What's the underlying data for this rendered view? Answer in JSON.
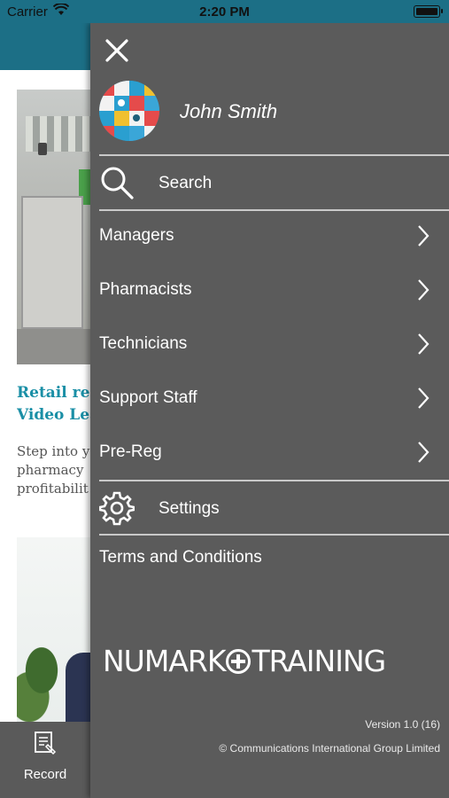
{
  "status_bar": {
    "carrier": "Carrier",
    "time": "2:20 PM"
  },
  "article": {
    "title_lines": [
      "Retail rea",
      "Video Lea"
    ],
    "body_lines": [
      "Step into y",
      "pharmacy",
      "profitabilit"
    ]
  },
  "tab_bar": {
    "record_label": "Record",
    "record_icon": "record-document-icon"
  },
  "drawer": {
    "user_name": "John Smith",
    "search_label": "Search",
    "menu_items": [
      {
        "label": "Managers"
      },
      {
        "label": "Pharmacists"
      },
      {
        "label": "Technicians"
      },
      {
        "label": "Support Staff"
      },
      {
        "label": "Pre-Reg"
      }
    ],
    "settings_label": "Settings",
    "terms_label": "Terms and Conditions",
    "brand_left": "NUMARK",
    "brand_right": "TRAINING",
    "version": "Version 1.0 (16)",
    "copyright": "© Communications International Group Limited"
  },
  "colors": {
    "header": "#1c6f86",
    "drawer_bg": "#5b5b5b",
    "accent_title": "#1a8fa6",
    "tab_bar": "#4d4d4d"
  }
}
